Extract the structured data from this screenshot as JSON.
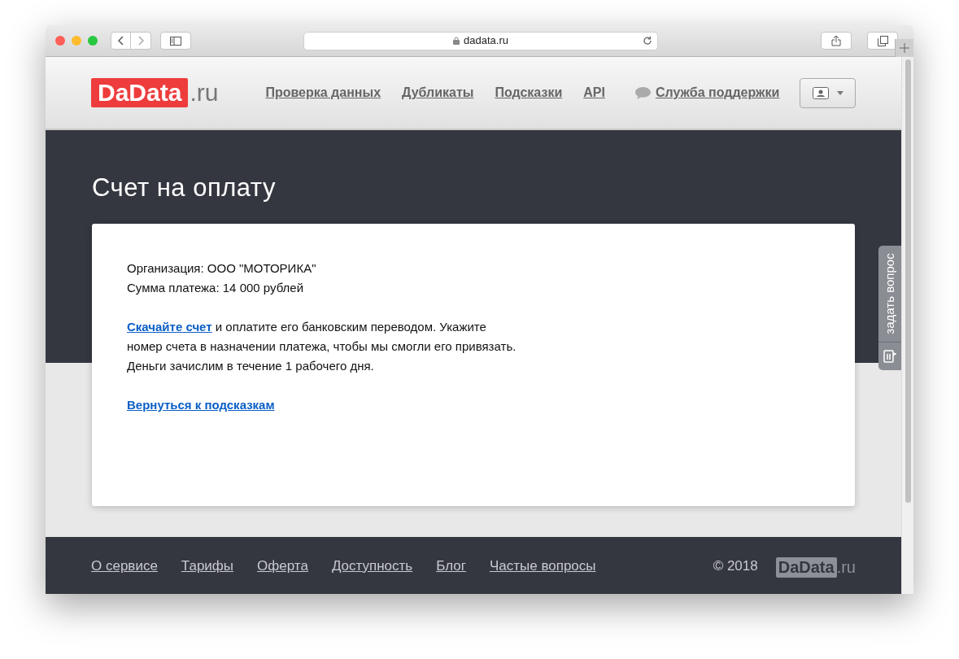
{
  "browser": {
    "url": "dadata.ru"
  },
  "header": {
    "logo": {
      "brand": "DaData",
      "suffix": ".ru"
    },
    "nav": [
      {
        "label": "Проверка данных",
        "kind": "link"
      },
      {
        "label": "Дубликаты",
        "kind": "link"
      },
      {
        "label": "Подсказки",
        "kind": "link"
      },
      {
        "label": "API",
        "kind": "link"
      },
      {
        "label": "Служба поддержки",
        "kind": "support"
      }
    ]
  },
  "title": "Счет на оплату",
  "card": {
    "details": [
      "Организация: ООО \"МОТОРИКА\"",
      "Сумма платежа: 14 000 рублей"
    ],
    "payment": {
      "link": "Скачайте счет",
      "text": " и оплатите его банковским переводом. Укажите номер счета в назначении платежа, чтобы мы смогли его привязать. Деньги зачислим в течение 1 рабочего дня."
    },
    "back_link": "Вернуться к подсказкам"
  },
  "feedback_tab": "задать вопрос",
  "footer": {
    "links": [
      "О сервисе",
      "Тарифы",
      "Оферта",
      "Доступность",
      "Блог",
      "Частые вопросы"
    ],
    "copyright": "© 2018",
    "logo": {
      "brand": "DaData",
      "suffix": ".ru"
    }
  }
}
